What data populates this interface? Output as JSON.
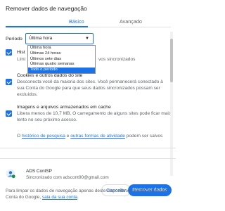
{
  "dialog": {
    "title": "Remover dados de navegação"
  },
  "tabs": [
    {
      "label": "Básico",
      "active": true
    },
    {
      "label": "Avançado",
      "active": false
    }
  ],
  "period": {
    "label": "Período",
    "selected": "Última hora",
    "options": [
      "Última hora",
      "Últimas 24 horas",
      "Últimos sete dias",
      "Últimas quatro semanas",
      "Todo o período"
    ],
    "highlighted": "Todo o período"
  },
  "options": [
    {
      "title_visible": "Hist",
      "desc_visible": "Limi",
      "desc_tail": "vos sincronizados",
      "checked": true
    },
    {
      "title": "Cookies e outros dados do site",
      "desc": "Desconecta você da maioria dos sites. Você permanecerá conectado à sua Conta do Google para que seus dados sincronizados possam ser excluídos.",
      "checked": true
    },
    {
      "title": "Imagens e arquivos armazenados em cache",
      "desc": "Libera menos de 10,7 MB. O carregamento de alguns sites pode ficar mais lento no seu próximo acesso.",
      "checked": true
    }
  ],
  "note": {
    "prefix": "O ",
    "link1": "histórico de pesquisa",
    "mid": " e ",
    "link2": "outras formas de atividade",
    "suffix": " podem ser salvos"
  },
  "buttons": {
    "cancel": "Cancelar",
    "remove": "Remover dados"
  },
  "account": {
    "name": "ADS ContSP",
    "sync_status": "Sincronizado com adscont90@gmail.com"
  },
  "footer": {
    "text": "Para limpar os dados de navegação apenas deste dispositivo e mantê-los na sua Conta do Google, ",
    "link": "saia da sua conta",
    "end": "."
  },
  "colors": {
    "accent": "#1a73e8",
    "text": "#202124",
    "secondary": "#5f6368"
  }
}
